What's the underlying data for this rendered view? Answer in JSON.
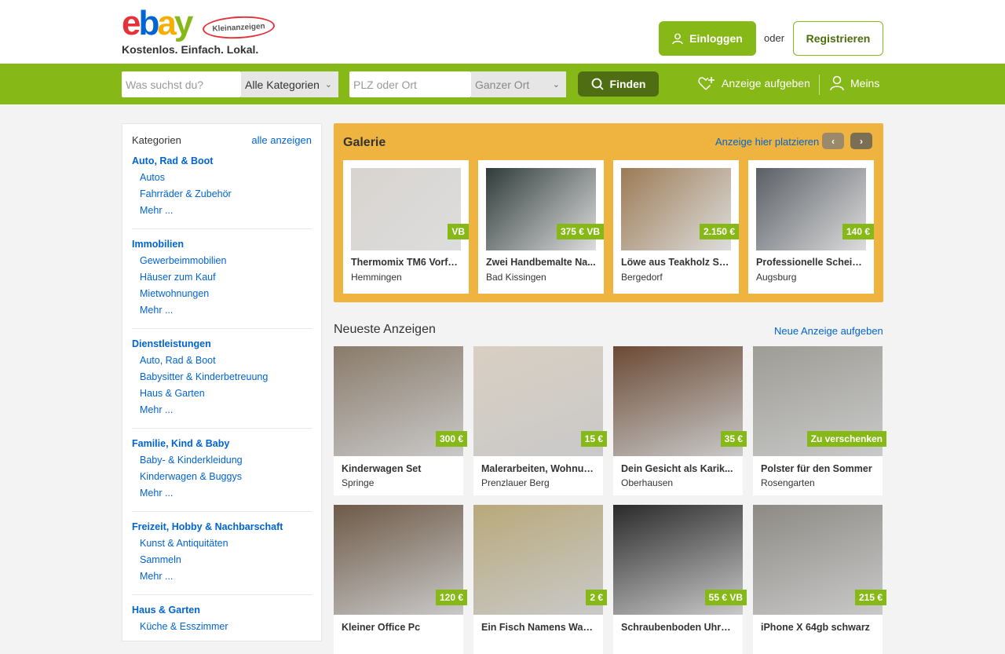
{
  "header": {
    "logo_text": "ebay",
    "logo_badge": "Kleinanzeigen",
    "tagline": "Kostenlos. Einfach. Lokal.",
    "login_label": "Einloggen",
    "oder": "oder",
    "register_label": "Registrieren"
  },
  "search": {
    "query_placeholder": "Was suchst du?",
    "category_value": "Alle Kategorien",
    "location_placeholder": "PLZ oder Ort",
    "radius_value": "Ganzer Ort",
    "find_label": "Finden",
    "post_ad_label": "Anzeige aufgeben",
    "meins_label": "Meins"
  },
  "sidebar": {
    "title": "Kategorien",
    "show_all": "alle anzeigen",
    "categories": [
      {
        "title": "Auto, Rad & Boot",
        "items": [
          "Autos",
          "Fahrräder & Zubehör",
          "Mehr ..."
        ]
      },
      {
        "title": "Immobilien",
        "items": [
          "Gewerbeimmobilien",
          "Häuser zum Kauf",
          "Mietwohnungen",
          "Mehr ..."
        ]
      },
      {
        "title": "Dienstleistungen",
        "items": [
          "Auto, Rad & Boot",
          "Babysitter & Kinderbetreuung",
          "Haus & Garten",
          "Mehr ..."
        ]
      },
      {
        "title": "Familie, Kind & Baby",
        "items": [
          "Baby- & Kinderkleidung",
          "Kinderwagen & Buggys",
          "Mehr ..."
        ]
      },
      {
        "title": "Freizeit, Hobby & Nachbarschaft",
        "items": [
          "Kunst & Antiquitäten",
          "Sammeln",
          "Mehr ..."
        ]
      },
      {
        "title": "Haus & Garten",
        "items": [
          "Küche & Esszimmer"
        ]
      }
    ]
  },
  "galerie": {
    "title": "Galerie",
    "place_link": "Anzeige hier platzieren",
    "items": [
      {
        "title": "Thermomix TM6 Vorfü...",
        "location": "Hemmingen",
        "price": "VB",
        "image_color": "#d8d4cf"
      },
      {
        "title": "Zwei Handbemalte Na...",
        "location": "Bad Kissingen",
        "price": "375 € VB",
        "image_color": "#2f3b3a"
      },
      {
        "title": "Löwe aus Teakholz Sk...",
        "location": "Bergedorf",
        "price": "2.150 €",
        "image_color": "#9c7b55"
      },
      {
        "title": "Professionelle Scheib...",
        "location": "Augsburg",
        "price": "140 €",
        "image_color": "#5a5f66"
      }
    ]
  },
  "neueste": {
    "title": "Neueste Anzeigen",
    "new_ad_link": "Neue Anzeige aufgeben",
    "items": [
      {
        "title": "Kinderwagen Set",
        "location": "Springe",
        "price": "300 €",
        "image_color": "#8a7b6a"
      },
      {
        "title": "Malerarbeiten, Wohnun...",
        "location": "Prenzlauer Berg",
        "price": "15 €",
        "image_color": "#d9cfc2"
      },
      {
        "title": "Dein Gesicht als Karik...",
        "location": "Oberhausen",
        "price": "35 €",
        "image_color": "#6b4a34"
      },
      {
        "title": "Polster für den Sommer",
        "location": "Rosengarten",
        "price": "Zu verschenken",
        "image_color": "#9d9c95"
      },
      {
        "title": "Kleiner Office Pc",
        "location": "",
        "price": "120 €",
        "image_color": "#6e5a47"
      },
      {
        "title": "Ein Fisch Namens Wan...",
        "location": "",
        "price": "2 €",
        "image_color": "#b9a97a"
      },
      {
        "title": "Schraubenboden Uhrm...",
        "location": "",
        "price": "55 € VB",
        "image_color": "#2a2a2a"
      },
      {
        "title": "iPhone X 64gb schwarz",
        "location": "",
        "price": "215 €",
        "image_color": "#8d8a84"
      }
    ]
  },
  "colors": {
    "brand_green": "#86b817",
    "dark_green": "#4f6e13",
    "link_blue": "#0064d2",
    "gallery_yellow": "#efb33f"
  }
}
